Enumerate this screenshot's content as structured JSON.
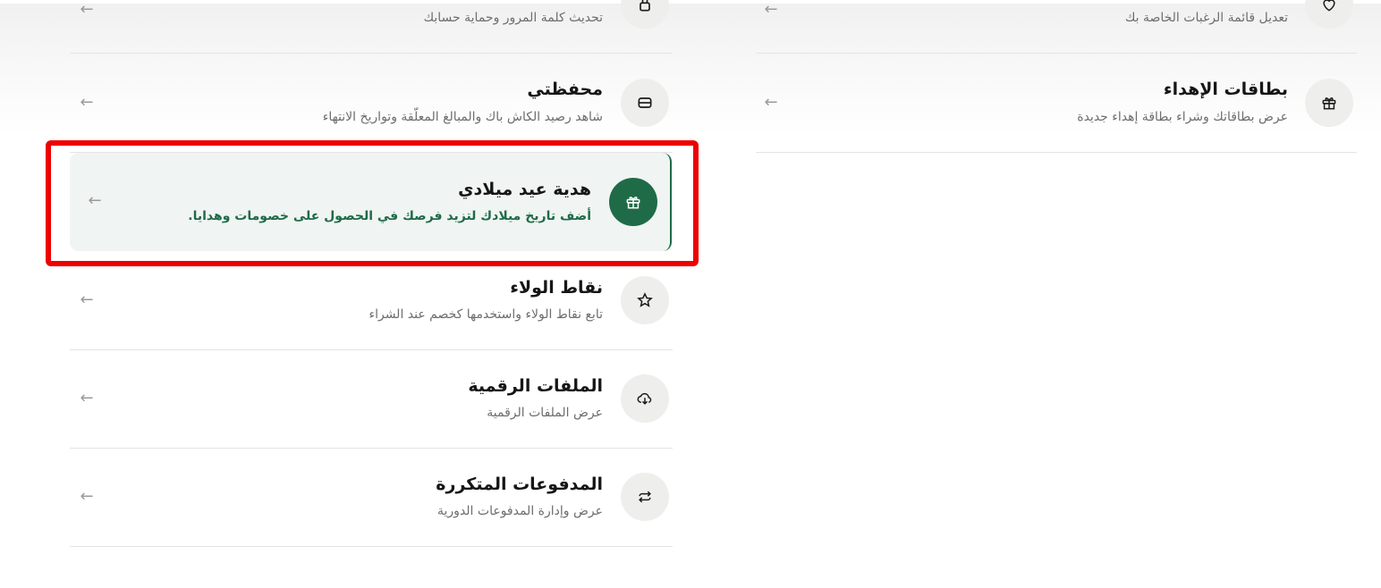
{
  "left_menu": {
    "password": {
      "description": "تحديث كلمة المرور وحماية حسابك"
    },
    "wallet": {
      "title": "محفظتي",
      "description": "شاهد رصيد الكاش باك والمبالغ المعلّقة وتواريخ الانتهاء"
    },
    "birthday": {
      "title": "هدية عيد ميلادي",
      "description": "أضف تاريخ ميلادك لتزيد فرصك في الحصول على خصومات وهدايا."
    },
    "loyalty": {
      "title": "نقاط الولاء",
      "description": "تابع نقاط الولاء واستخدمها كخصم عند الشراء"
    },
    "digital_files": {
      "title": "الملفات الرقمية",
      "description": "عرض الملفات الرقمية"
    },
    "recurring_payments": {
      "title": "المدفوعات المتكررة",
      "description": "عرض وإدارة المدفوعات الدورية"
    }
  },
  "right_menu": {
    "wishlist": {
      "description": "تعديل قائمة الرغبات الخاصة بك"
    },
    "gift_cards": {
      "title": "بطاقات الإهداء",
      "description": "عرض بطاقاتك وشراء بطاقة إهداء جديدة"
    }
  },
  "icons": {
    "arrow": "←",
    "password": "lock-icon",
    "wallet": "wallet-icon",
    "birthday": "gift-icon",
    "loyalty": "star-icon",
    "digital_files": "cloud-download-icon",
    "recurring_payments": "repeat-icon",
    "wishlist": "heart-icon",
    "gift_cards": "gift-icon"
  },
  "colors": {
    "accent": "#1f6b48",
    "highlight_outline": "#ee0000",
    "icon_bg": "#eeeeec",
    "highlight_bg": "#f0f4f2"
  }
}
